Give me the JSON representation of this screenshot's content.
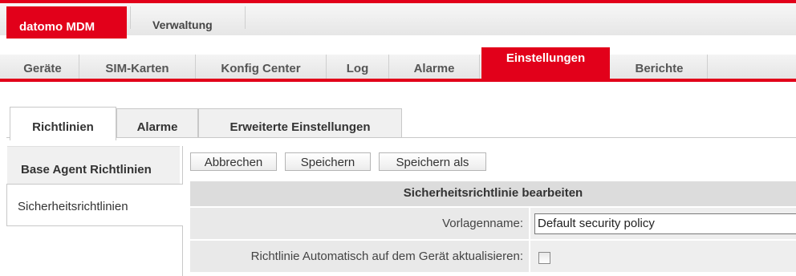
{
  "brand": {
    "label": "datomo MDM"
  },
  "topnav": {
    "admin_label": "Verwaltung"
  },
  "mainnav": {
    "items": [
      {
        "label": "Geräte"
      },
      {
        "label": "SIM-Karten"
      },
      {
        "label": "Konfig Center"
      },
      {
        "label": "Log"
      },
      {
        "label": "Alarme"
      },
      {
        "label": "Einstellungen",
        "active": true
      },
      {
        "label": "Berichte"
      }
    ]
  },
  "subtabs": [
    {
      "label": "Richtlinien",
      "active": true
    },
    {
      "label": "Alarme"
    },
    {
      "label": "Erweiterte Einstellungen"
    }
  ],
  "sidebar": {
    "items": [
      {
        "label": "Base Agent Richtlinien"
      },
      {
        "label": "Sicherheitsrichtlinien",
        "active": true
      }
    ]
  },
  "toolbar": {
    "cancel_label": "Abbrechen",
    "save_label": "Speichern",
    "save_as_label": "Speichern als"
  },
  "form": {
    "title": "Sicherheitsrichtlinie bearbeiten",
    "template_name_label": "Vorlagenname:",
    "template_name_value": "Default security policy",
    "auto_update_label": "Richtlinie Automatisch auf dem Gerät aktualisieren:",
    "auto_update_checked": false
  },
  "colors": {
    "accent": "#e2001a",
    "header_bg": "#dcdcdc",
    "row_bg": "#e9e9e9"
  }
}
